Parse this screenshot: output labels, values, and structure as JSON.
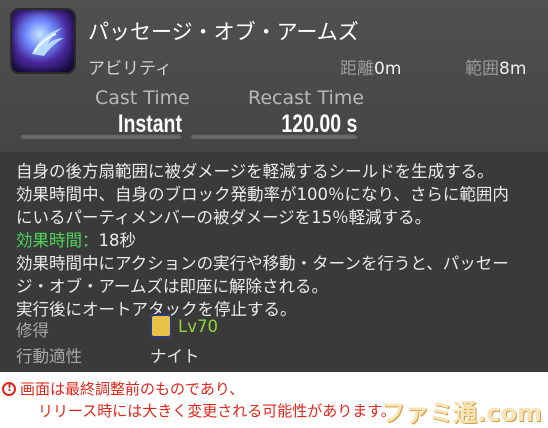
{
  "action": {
    "name": "パッセージ・オブ・アームズ",
    "category": "アビリティ",
    "range_label": "距離",
    "range_value": "0m",
    "radius_label": "範囲",
    "radius_value": "8m",
    "cast_label": "Cast Time",
    "cast_value": "Instant",
    "recast_label": "Recast Time",
    "recast_value": "120.00 s"
  },
  "description": {
    "line1": "自身の後方扇範囲に被ダメージを軽減するシールドを生成する。",
    "line2": "効果時間中、自身のブロック発動率が100％になり、さらに範囲内",
    "line3": "にいるパーティメンバーの被ダメージを15％軽減する。",
    "duration_label": "効果時間：",
    "duration_value": "18秒",
    "line5": "効果時間中にアクションの実行や移動・ターンを行うと、パッセー",
    "line6": "ジ・オブ・アームズは即座に解除される。",
    "line7": "実行後にオートアタックを停止する。"
  },
  "meta": {
    "acquired_label": "修得",
    "acquired_value": "Lv70",
    "job_label": "行動適性",
    "job_value": "ナイト"
  },
  "notice": {
    "line1": "画面は最終調整前のものであり、",
    "line2": "リリース時には大きく変更される可能性があります。"
  },
  "watermark": "ファミ通.com"
}
